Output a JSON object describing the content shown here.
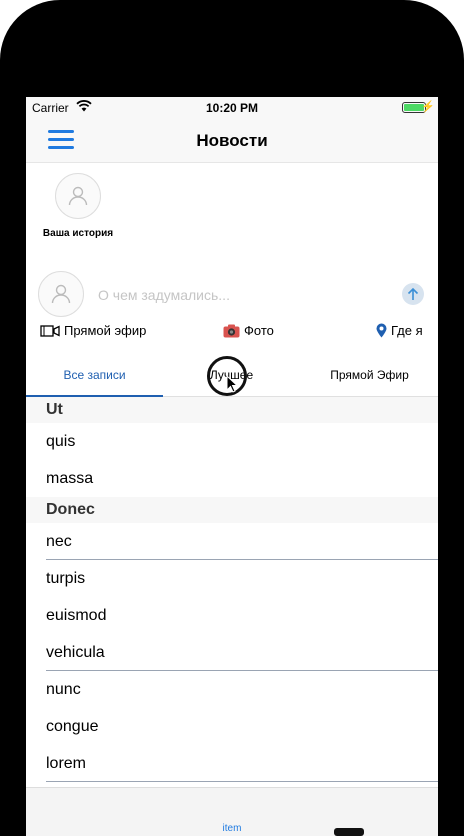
{
  "status": {
    "carrier": "Carrier",
    "time": "10:20 PM",
    "battery_level": 1.0
  },
  "nav": {
    "title": "Новости",
    "menu_icon": "hamburger-menu-icon"
  },
  "stories": {
    "items": [
      {
        "label": "Ваша история"
      }
    ]
  },
  "composer": {
    "placeholder": "О чем задумались..."
  },
  "actions": {
    "live": "Прямой эфир",
    "photo": "Фото",
    "location": "Где я"
  },
  "tabs": [
    {
      "label": "Все записи",
      "active": true
    },
    {
      "label": "Лучшее",
      "active": false
    },
    {
      "label": "Прямой Эфир",
      "active": false
    }
  ],
  "sections": [
    {
      "title": "Ut",
      "rows": [
        "quis",
        "massa"
      ]
    },
    {
      "title": "Donec",
      "rows": [
        "nec",
        "turpis",
        "euismod",
        "vehicula",
        "nunc",
        "congue",
        "lorem"
      ]
    }
  ],
  "tab_bar": {
    "item": "item"
  },
  "colors": {
    "accent": "#1f7ae0",
    "tab_active": "#1f5fb0",
    "battery": "#4cd964"
  }
}
